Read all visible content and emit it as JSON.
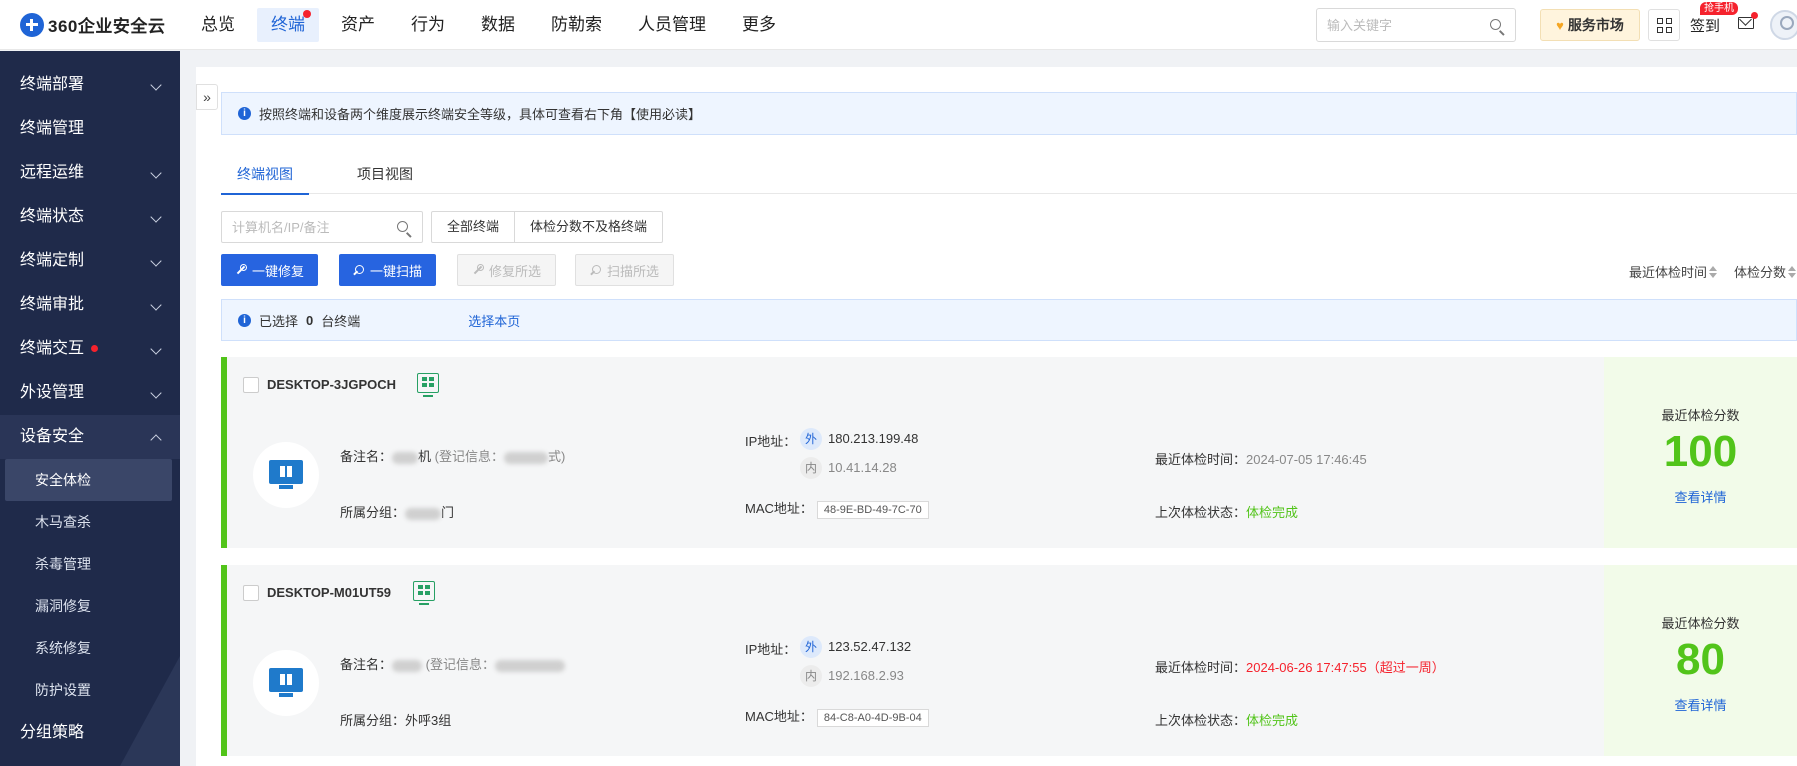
{
  "logo": {
    "text": "360企业安全云"
  },
  "nav": [
    {
      "label": "总览"
    },
    {
      "label": "终端"
    },
    {
      "label": "资产"
    },
    {
      "label": "行为"
    },
    {
      "label": "数据"
    },
    {
      "label": "防勒索"
    },
    {
      "label": "人员管理"
    },
    {
      "label": "更多"
    }
  ],
  "top_search": {
    "placeholder": "输入关键字"
  },
  "service_market": "服务市场",
  "signin": "签到",
  "phone_badge": "抢手机",
  "sidebar": {
    "items": [
      {
        "label": "终端部署"
      },
      {
        "label": "终端管理"
      },
      {
        "label": "远程运维"
      },
      {
        "label": "终端状态"
      },
      {
        "label": "终端定制"
      },
      {
        "label": "终端审批"
      },
      {
        "label": "终端交互"
      },
      {
        "label": "外设管理"
      },
      {
        "label": "设备安全"
      },
      {
        "label": "分组策略"
      }
    ],
    "sub_items": [
      {
        "label": "安全体检"
      },
      {
        "label": "木马查杀"
      },
      {
        "label": "杀毒管理"
      },
      {
        "label": "漏洞修复"
      },
      {
        "label": "系统修复"
      },
      {
        "label": "防护设置"
      }
    ]
  },
  "notice": "按照终端和设备两个维度展示终端安全等级，具体可查看右下角【使用必读】",
  "tabs": [
    {
      "label": "终端视图"
    },
    {
      "label": "项目视图"
    }
  ],
  "filter": {
    "placeholder": "计算机名/IP/备注"
  },
  "segments": [
    {
      "label": "全部终端"
    },
    {
      "label": "体检分数不及格终端"
    }
  ],
  "buttons": {
    "fix": "一键修复",
    "scan": "一键扫描",
    "fix_selected": "修复所选",
    "scan_selected": "扫描所选"
  },
  "sort": {
    "time": "最近体检时间",
    "score": "体检分数"
  },
  "selection": {
    "prefix": "已选择",
    "count": "0",
    "suffix": "台终端",
    "select_page": "选择本页"
  },
  "labels": {
    "remark": "备注名：",
    "reg_prefix": "(登记信息：",
    "reg_suffix": "式)",
    "group": "所属分组：",
    "ip": "IP地址：",
    "out": "外",
    "in": "内",
    "mac": "MAC地址：",
    "last_time": "最近体检时间：",
    "last_status": "上次体检状态：",
    "score_title": "最近体检分数",
    "detail": "查看详情"
  },
  "cards": [
    {
      "hostname": "DESKTOP-3JGPOCH",
      "remark_suffix": "机",
      "group_suffix": "门",
      "ip_out": "180.213.199.48",
      "ip_in": "10.41.14.28",
      "mac": "48-9E-BD-49-7C-70",
      "time": "2024-07-05 17:46:45",
      "status": "体检完成",
      "score": "100"
    },
    {
      "hostname": "DESKTOP-M01UT59",
      "remark_suffix": "",
      "group": "外呼3组",
      "ip_out": "123.52.47.132",
      "ip_in": "192.168.2.93",
      "mac": "84-C8-A0-4D-9B-04",
      "time": "2024-06-26 17:47:55（超过一周）",
      "status": "体检完成",
      "score": "80"
    }
  ],
  "colors": {
    "accent": "#1f64d6",
    "good": "#52c41a",
    "warn": "#f5222d",
    "sidebar": "#1f2a4a"
  }
}
